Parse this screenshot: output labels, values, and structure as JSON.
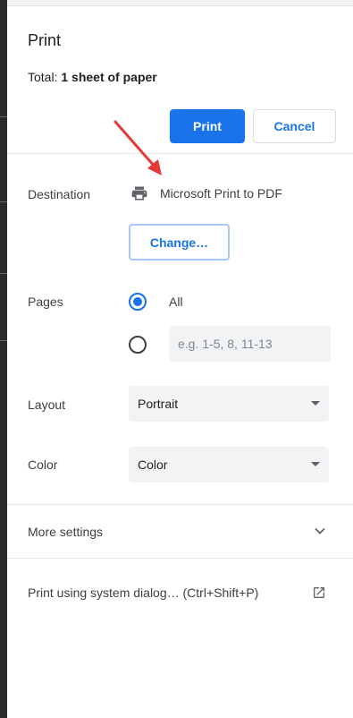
{
  "dialog": {
    "title": "Print",
    "summary_prefix": "Total: ",
    "summary_value": "1 sheet of paper"
  },
  "actions": {
    "print_label": "Print",
    "cancel_label": "Cancel"
  },
  "destination": {
    "label": "Destination",
    "icon": "printer-icon",
    "value": "Microsoft Print to PDF",
    "change_label": "Change…"
  },
  "pages": {
    "label": "Pages",
    "all_label": "All",
    "selected": "All",
    "custom_placeholder": "e.g. 1-5, 8, 11-13"
  },
  "layout": {
    "label": "Layout",
    "value": "Portrait"
  },
  "color": {
    "label": "Color",
    "value": "Color"
  },
  "more_settings": {
    "label": "More settings",
    "icon": "chevron-down-icon"
  },
  "system_dialog": {
    "label": "Print using system dialog… (Ctrl+Shift+P)",
    "icon": "open-in-new-icon"
  },
  "colors": {
    "accent": "#1a73e8",
    "annotation_arrow": "#e53935",
    "field_background": "#f1f3f4"
  }
}
